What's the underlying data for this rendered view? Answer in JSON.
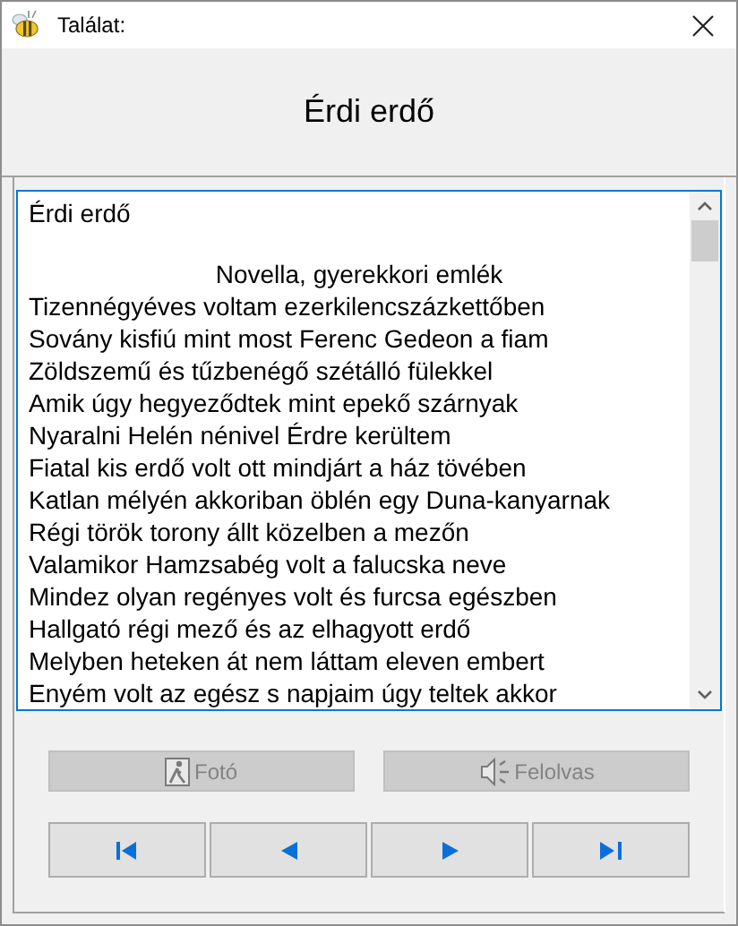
{
  "window": {
    "title": "Találat:"
  },
  "header": {
    "title": "Érdi erdő"
  },
  "text_box": {
    "lines": [
      {
        "kind": "text",
        "text": "Érdi erdő"
      },
      {
        "kind": "blank"
      },
      {
        "kind": "centered",
        "text": "Novella, gyerekkori emlék"
      },
      {
        "kind": "text",
        "text": "Tizennégyéves voltam ezerkilencszázkettőben"
      },
      {
        "kind": "text",
        "text": "Sovány kisfiú mint most Ferenc Gedeon a fiam"
      },
      {
        "kind": "text",
        "text": "Zöldszemű és tűzbenégő szétálló fülekkel"
      },
      {
        "kind": "text",
        "text": "Amik úgy hegyeződtek mint epekő szárnyak"
      },
      {
        "kind": "text",
        "text": "Nyaralni Helén nénivel Érdre kerültem"
      },
      {
        "kind": "text",
        "text": "Fiatal kis erdő volt ott mindjárt a ház tövében"
      },
      {
        "kind": "text",
        "text": "Katlan mélyén akkoriban öblén egy Duna-kanyarnak"
      },
      {
        "kind": "text",
        "text": "Régi török torony állt közelben a mezőn"
      },
      {
        "kind": "text",
        "text": "Valamikor Hamzsabég volt a falucska neve"
      },
      {
        "kind": "text",
        "text": "Mindez olyan regényes volt és furcsa egészben"
      },
      {
        "kind": "text",
        "text": "Hallgató régi mező és az elhagyott erdő"
      },
      {
        "kind": "text",
        "text": "Melyben heteken át nem láttam eleven embert"
      },
      {
        "kind": "text",
        "text": "Enyém volt az egész s napjaim úgy teltek akkor"
      }
    ]
  },
  "action_buttons": [
    {
      "kind": "photo",
      "label": "Fotó",
      "disabled": true
    },
    {
      "kind": "speak",
      "label": "Felolvas",
      "disabled": true
    }
  ],
  "nav_buttons": [
    {
      "kind": "first",
      "disabled": false
    },
    {
      "kind": "previous",
      "disabled": false
    },
    {
      "kind": "next",
      "disabled": false
    },
    {
      "kind": "last",
      "disabled": false
    }
  ]
}
